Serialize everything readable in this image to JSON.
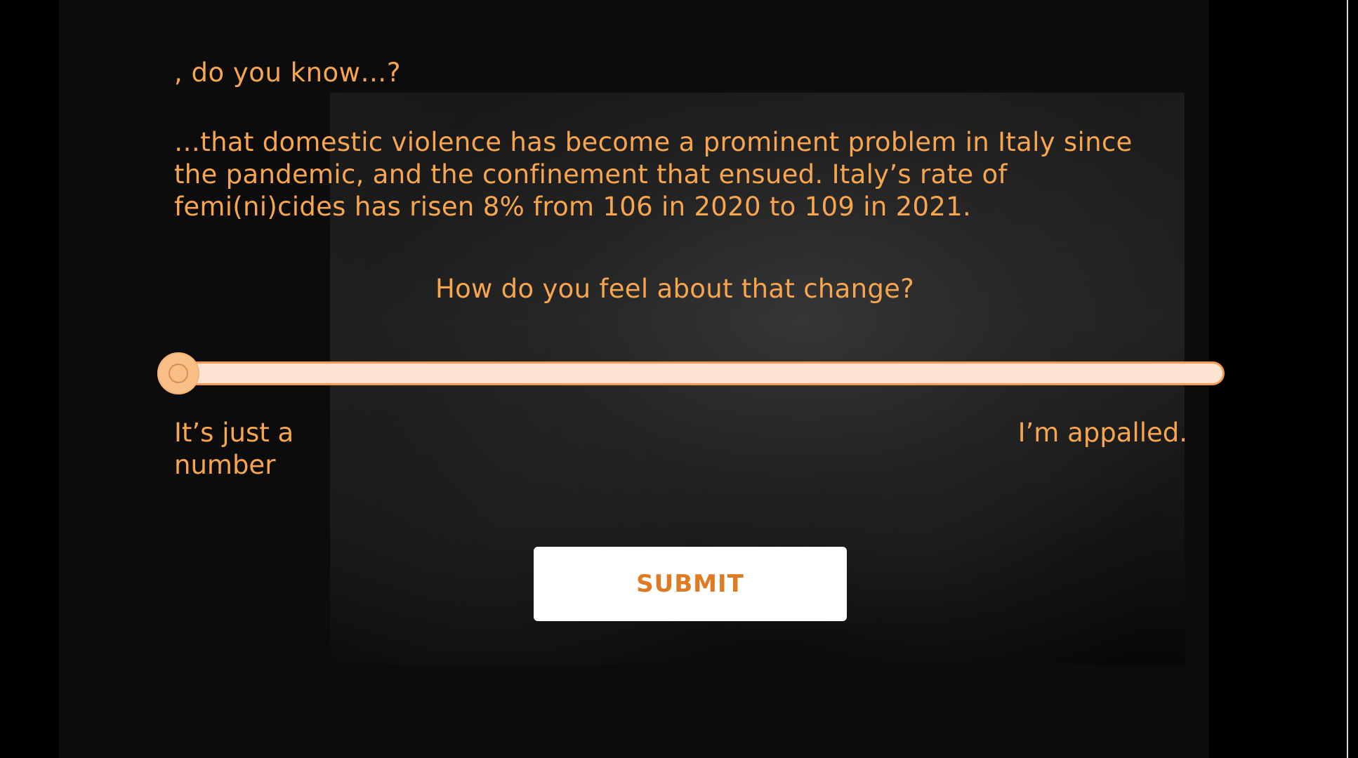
{
  "intro": ", do you know…?",
  "fact": "…that domestic violence has become a prominent problem in Italy since the pandemic, and the confinement that ensued. Italy’s rate of femi(ni)cides has risen 8% from 106 in 2020 to 109 in 2021.",
  "question": "How do you feel about that change?",
  "slider": {
    "value": 0,
    "label_left": "It’s just a number",
    "label_right": "I’m appalled."
  },
  "submit_label": "SUBMIT",
  "colors": {
    "accent": "#f7a64f",
    "button_text": "#e07a22",
    "track_fill": "#fde4d2",
    "thumb": "#f8bf87"
  }
}
